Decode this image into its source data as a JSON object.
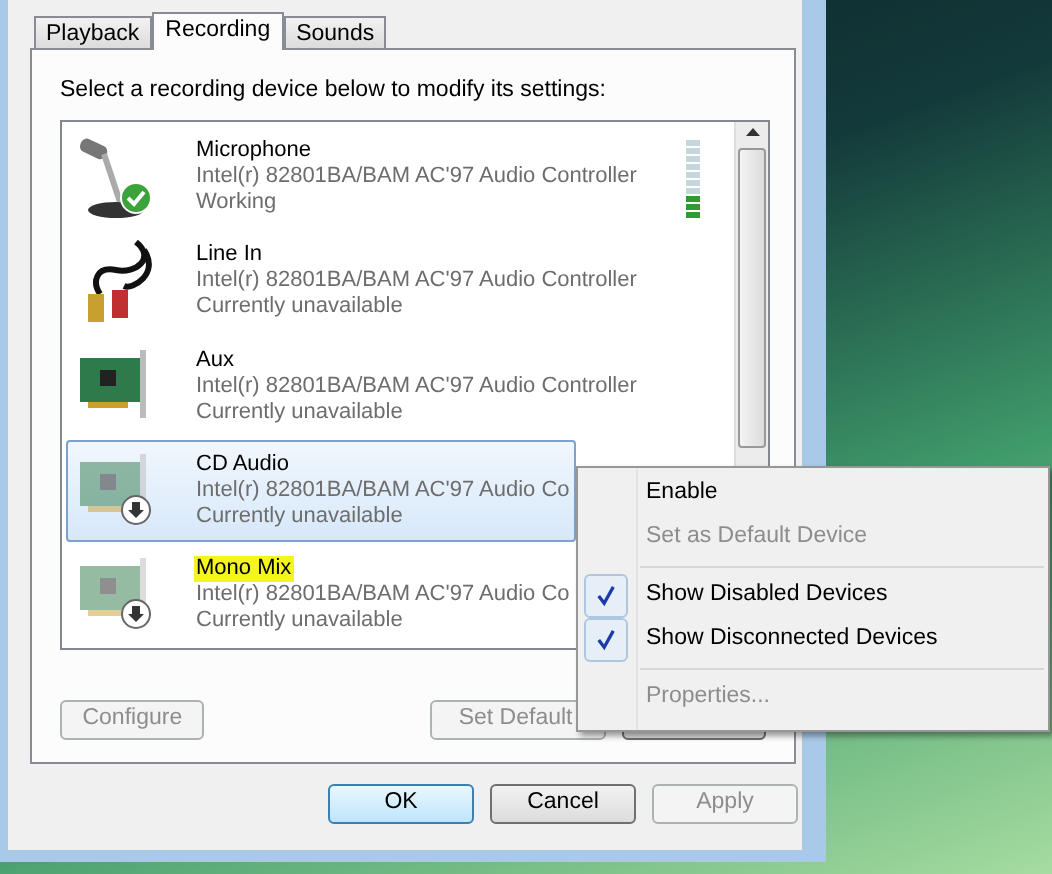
{
  "tabs": [
    {
      "label": "Playback",
      "selected": false
    },
    {
      "label": "Recording",
      "selected": true
    },
    {
      "label": "Sounds",
      "selected": false
    }
  ],
  "instruction": "Select a recording device below to modify its settings:",
  "devices": [
    {
      "kind": "microphone",
      "name": "Microphone",
      "driver": "Intel(r) 82801BA/BAM AC'97 Audio Controller",
      "status": "Working",
      "default": true,
      "disabled": false,
      "selected": false,
      "highlighted": false,
      "level": 0.3
    },
    {
      "kind": "cable",
      "name": "Line In",
      "driver": "Intel(r) 82801BA/BAM AC'97 Audio Controller",
      "status": "Currently unavailable",
      "default": false,
      "disabled": false,
      "selected": false,
      "highlighted": false
    },
    {
      "kind": "card",
      "name": "Aux",
      "driver": "Intel(r) 82801BA/BAM AC'97 Audio Controller",
      "status": "Currently unavailable",
      "default": false,
      "disabled": false,
      "selected": false,
      "highlighted": false
    },
    {
      "kind": "card",
      "name": "CD Audio",
      "driver": "Intel(r) 82801BA/BAM AC'97 Audio Co",
      "status": "Currently unavailable",
      "default": false,
      "disabled": true,
      "selected": true,
      "highlighted": false
    },
    {
      "kind": "card",
      "name": "Mono Mix",
      "driver": "Intel(r) 82801BA/BAM AC'97 Audio Co",
      "status": "Currently unavailable",
      "default": false,
      "disabled": true,
      "selected": false,
      "highlighted": true
    }
  ],
  "panel_buttons": [
    {
      "label": "Configure",
      "disabled": true
    },
    {
      "label": "Set Default",
      "disabled": true
    },
    {
      "disabled": false
    }
  ],
  "dialog_buttons": [
    {
      "label": "OK",
      "disabled": false,
      "default": true
    },
    {
      "label": "Cancel",
      "disabled": false,
      "default": false
    },
    {
      "label": "Apply",
      "disabled": true,
      "default": false
    }
  ],
  "context_menu": [
    {
      "kind": "item",
      "label": "Enable",
      "disabled": false,
      "checked": false
    },
    {
      "kind": "item",
      "label": "Set as Default Device",
      "disabled": true,
      "checked": false
    },
    {
      "kind": "separator"
    },
    {
      "kind": "item",
      "label": "Show Disabled Devices",
      "disabled": false,
      "checked": true
    },
    {
      "kind": "item",
      "label": "Show Disconnected Devices",
      "disabled": false,
      "checked": true
    },
    {
      "kind": "separator"
    },
    {
      "kind": "item",
      "label": "Properties...",
      "disabled": true,
      "checked": false
    }
  ]
}
